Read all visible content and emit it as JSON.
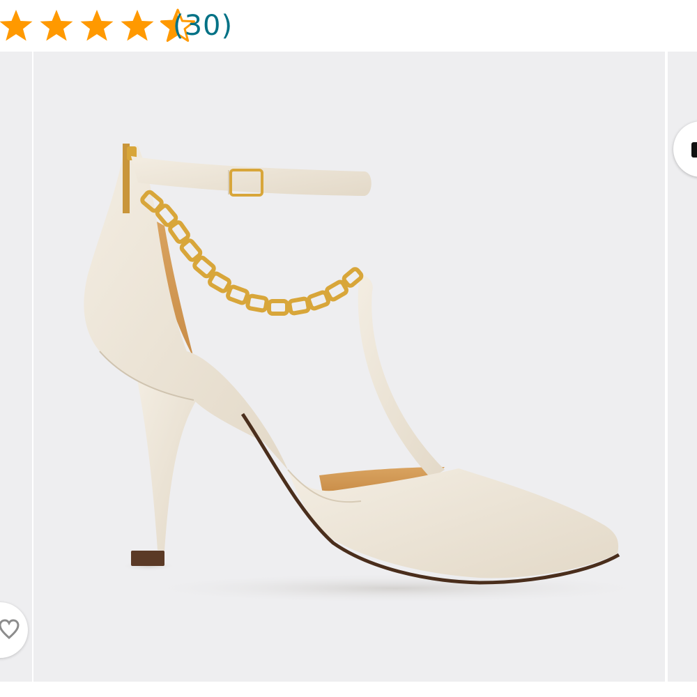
{
  "rating": {
    "value": 4.5,
    "max": 5,
    "star_color": "#ff9900",
    "review_count": "(30)",
    "review_link_color": "#007185"
  },
  "gallery": {
    "background": "#eeeef0",
    "product_color": "#ece4d6",
    "chain_color": "#d8a63a",
    "icons": {
      "share": "share-icon",
      "wishlist": "heart-icon"
    }
  }
}
